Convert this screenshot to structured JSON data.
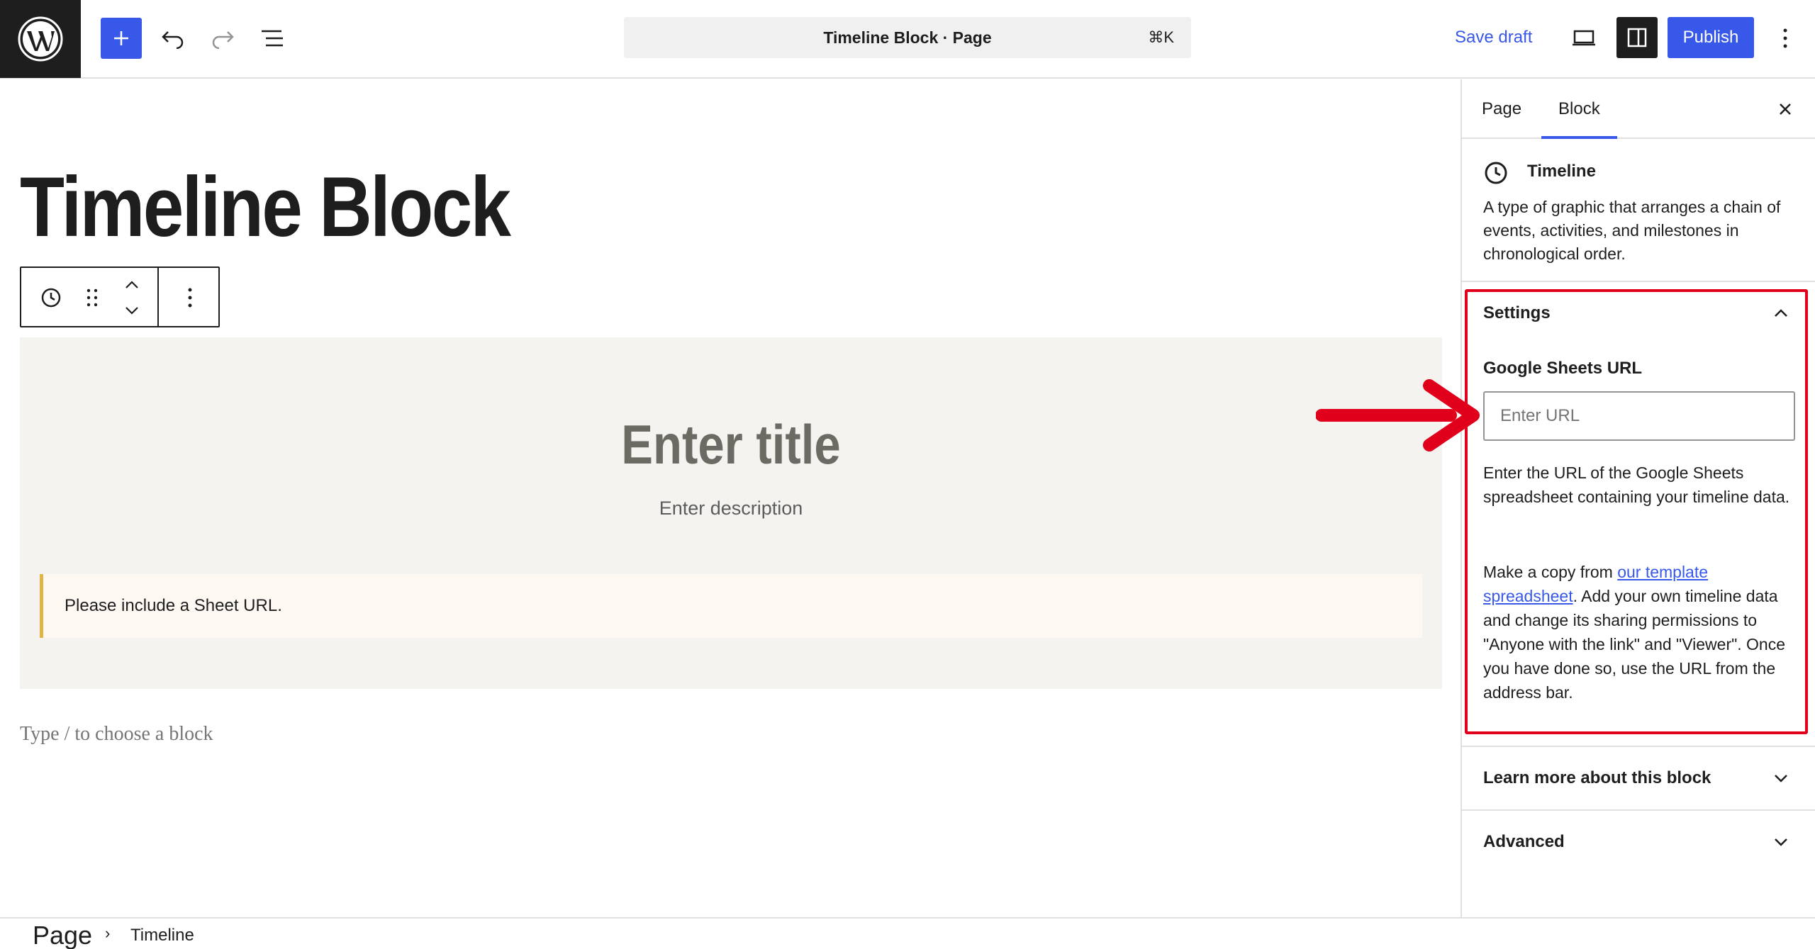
{
  "header": {
    "logo_icon": "wordpress-logo-icon",
    "document_title": "Timeline Block · Page",
    "shortcut": "⌘K",
    "save_draft": "Save draft",
    "publish": "Publish",
    "accent_color": "#3858e9"
  },
  "editor": {
    "page_title": "Timeline Block",
    "block": {
      "icon": "clock-icon",
      "title_placeholder": "Enter title",
      "description_placeholder": "Enter description",
      "notice": "Please include a Sheet URL."
    },
    "appender": "Type / to choose a block"
  },
  "breadcrumb": {
    "root": "Page",
    "item": "Timeline"
  },
  "sidebar": {
    "tabs": [
      "Page",
      "Block"
    ],
    "active_tab": "Block",
    "card": {
      "title": "Timeline",
      "description": "A type of graphic that arranges a chain of events, activities, and milestones in chronological order."
    },
    "settings": {
      "title": "Settings",
      "field_label": "Google Sheets URL",
      "field_placeholder": "Enter URL",
      "field_value": "",
      "help_1": "Enter the URL of the Google Sheets spreadsheet containing your timeline data.",
      "help_2_prefix": "Make a copy from ",
      "help_2_link": "our template spreadsheet",
      "help_2_suffix": ". Add your own timeline data and change its sharing permissions to \"Anyone with the link\" and \"Viewer\". Once you have done so, use the URL from the address bar.",
      "highlight_color": "#e0001b"
    },
    "panels": [
      {
        "title": "Learn more about this block"
      },
      {
        "title": "Advanced"
      }
    ]
  }
}
